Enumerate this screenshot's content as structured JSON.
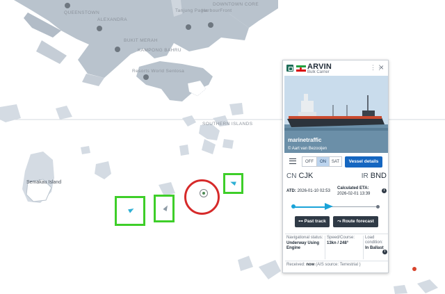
{
  "map": {
    "labels": [
      "QUEENSTOWN",
      "DOWNTOWN CORE",
      "ALEXANDRA",
      "BUKIT MERAH",
      "KAMPONG BAHRU",
      "SOUTHERN ISLANDS",
      "Resorts World Sentosa",
      "Semakau Island",
      "Tanjung Pagar",
      "HarbourFront"
    ],
    "island_label": "Semakau Island",
    "southern_islands_label": "SOUTHERN ISLANDS",
    "colors": {
      "water": "#ffffff",
      "land": "#d4dbe3",
      "urban": "#b9c3cd",
      "highlight": "#3ece29",
      "target_ring": "#d62a2a",
      "ship": "#2fb0d4"
    }
  },
  "vessel_panel": {
    "name": "ARVIN",
    "vessel_type": "Bulk Carrier",
    "type_icon": "ship-type-icon",
    "flag": "Iran",
    "photo_brand": "marinetraffic",
    "photo_credit": "© Aart van Bezooijen",
    "map_modes": {
      "off": "OFF",
      "on": "ON",
      "sat": "SAT",
      "selected": "ON"
    },
    "details_button": "Vessel details",
    "departure": {
      "country": "CN",
      "port": "CJK"
    },
    "destination": {
      "country": "IR",
      "port": "BND"
    },
    "atd_label": "ATD:",
    "atd_value": "2026-01-10 02:53",
    "eta_label": "Calculated ETA:",
    "eta_value": "2026-02-01 13:39",
    "voyage_progress": 0.42,
    "past_track_label": "Past track",
    "route_forecast_label": "Route forecast",
    "nav_status_label": "Navigational status:",
    "nav_status_value": "Underway Using Engine",
    "speed_label": "Speed/Course:",
    "speed_value": "13kn / 248°",
    "load_label": "Load condition:",
    "load_value": "In Ballast",
    "received_label": "Received:",
    "received_value": "now",
    "received_source": "(AIS source: Terrestrial )"
  }
}
